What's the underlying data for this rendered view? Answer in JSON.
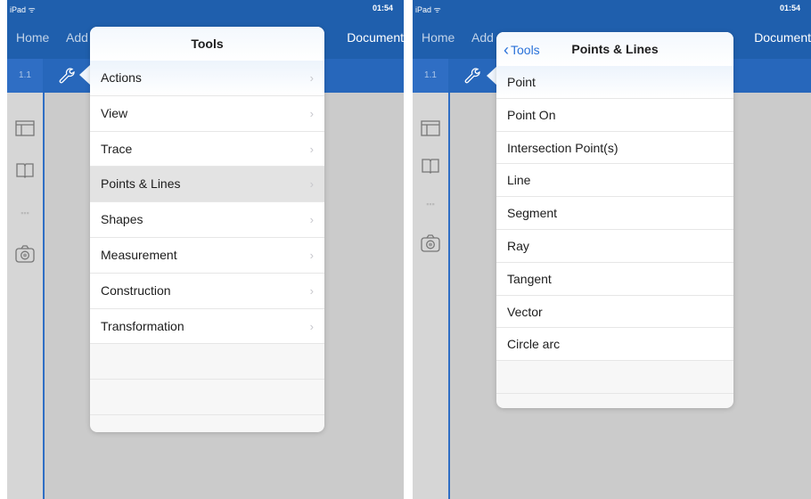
{
  "left": {
    "status": {
      "carrier": "iPad ᯤ",
      "time": "01:54"
    },
    "nav": {
      "home": "Home",
      "add": "Add",
      "document": "Document"
    },
    "page_tab": "1.1",
    "popover": {
      "title": "Tools",
      "items": [
        {
          "label": "Actions",
          "chevron": "›"
        },
        {
          "label": "View",
          "chevron": "›"
        },
        {
          "label": "Trace",
          "chevron": "›"
        },
        {
          "label": "Points & Lines",
          "chevron": "›"
        },
        {
          "label": "Shapes",
          "chevron": "›"
        },
        {
          "label": "Measurement",
          "chevron": "›"
        },
        {
          "label": "Construction",
          "chevron": "›"
        },
        {
          "label": "Transformation",
          "chevron": "›"
        }
      ],
      "selected_index": 3
    }
  },
  "right": {
    "status": {
      "carrier": "iPad ᯤ",
      "time": "01:54"
    },
    "nav": {
      "home": "Home",
      "add": "Add",
      "document": "Document"
    },
    "page_tab": "1.1",
    "popover": {
      "back_label": "Tools",
      "back_chevron": "‹",
      "title": "Points & Lines",
      "items": [
        {
          "label": "Point"
        },
        {
          "label": "Point On"
        },
        {
          "label": "Intersection Point(s)"
        },
        {
          "label": "Line"
        },
        {
          "label": "Segment"
        },
        {
          "label": "Ray"
        },
        {
          "label": "Tangent"
        },
        {
          "label": "Vector"
        },
        {
          "label": "Circle arc"
        }
      ]
    }
  },
  "icons": {
    "wrench": "wrench-icon",
    "page_sorter": "page-sorter-icon",
    "book": "book-icon",
    "faded_tool": "faded-tool-icon",
    "camera": "camera-icon"
  },
  "colors": {
    "nav_blue": "#1f5fad",
    "page_bar_blue": "#2767bb",
    "back_link": "#2a72d9",
    "selected_row": "#e3e3e3",
    "canvas_gray": "#cbcbcb"
  }
}
